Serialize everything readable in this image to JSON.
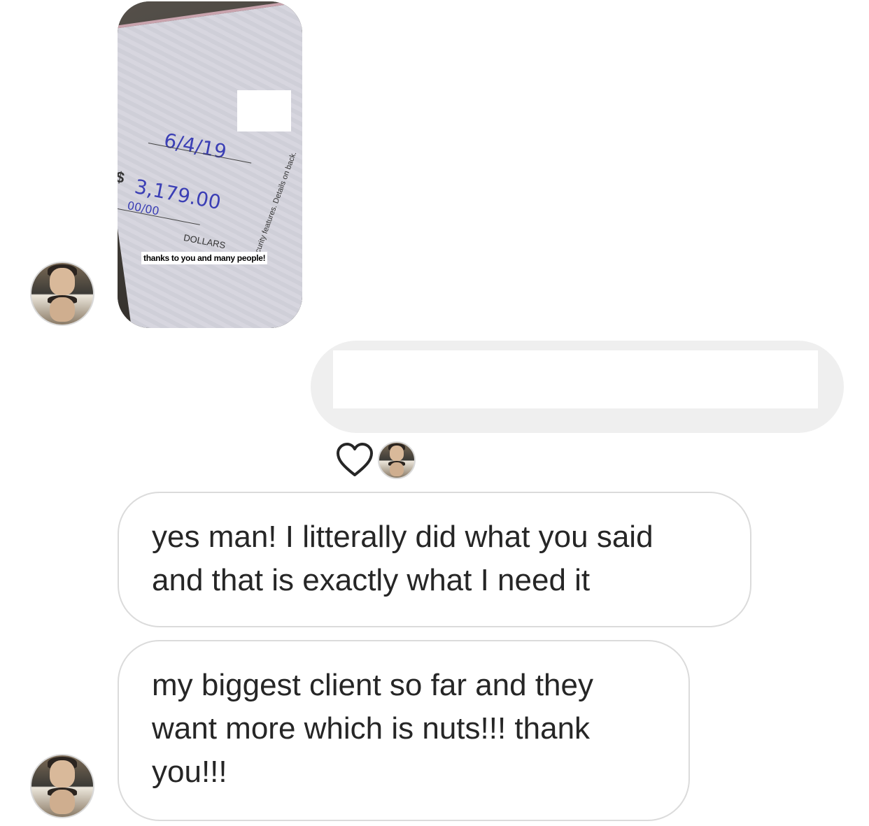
{
  "thread": {
    "photo_message": {
      "check_date": "6/4/19",
      "check_dollar_sign": "$",
      "check_amount": "3,179.00",
      "check_cents": "00/00",
      "check_dollars_label": "DOLLARS",
      "check_security_text": "Security features. Details on back.",
      "caption": "thanks to you and many people!"
    },
    "sent_message": {
      "text": ""
    },
    "reaction": {
      "icon": "heart-icon"
    },
    "received_messages": [
      {
        "text": "yes man! I litterally did what you said\nand that is exactly what I need it"
      },
      {
        "text": "my biggest client so far and they\nwant more which is nuts!!! thank\nyou!!!"
      }
    ]
  }
}
